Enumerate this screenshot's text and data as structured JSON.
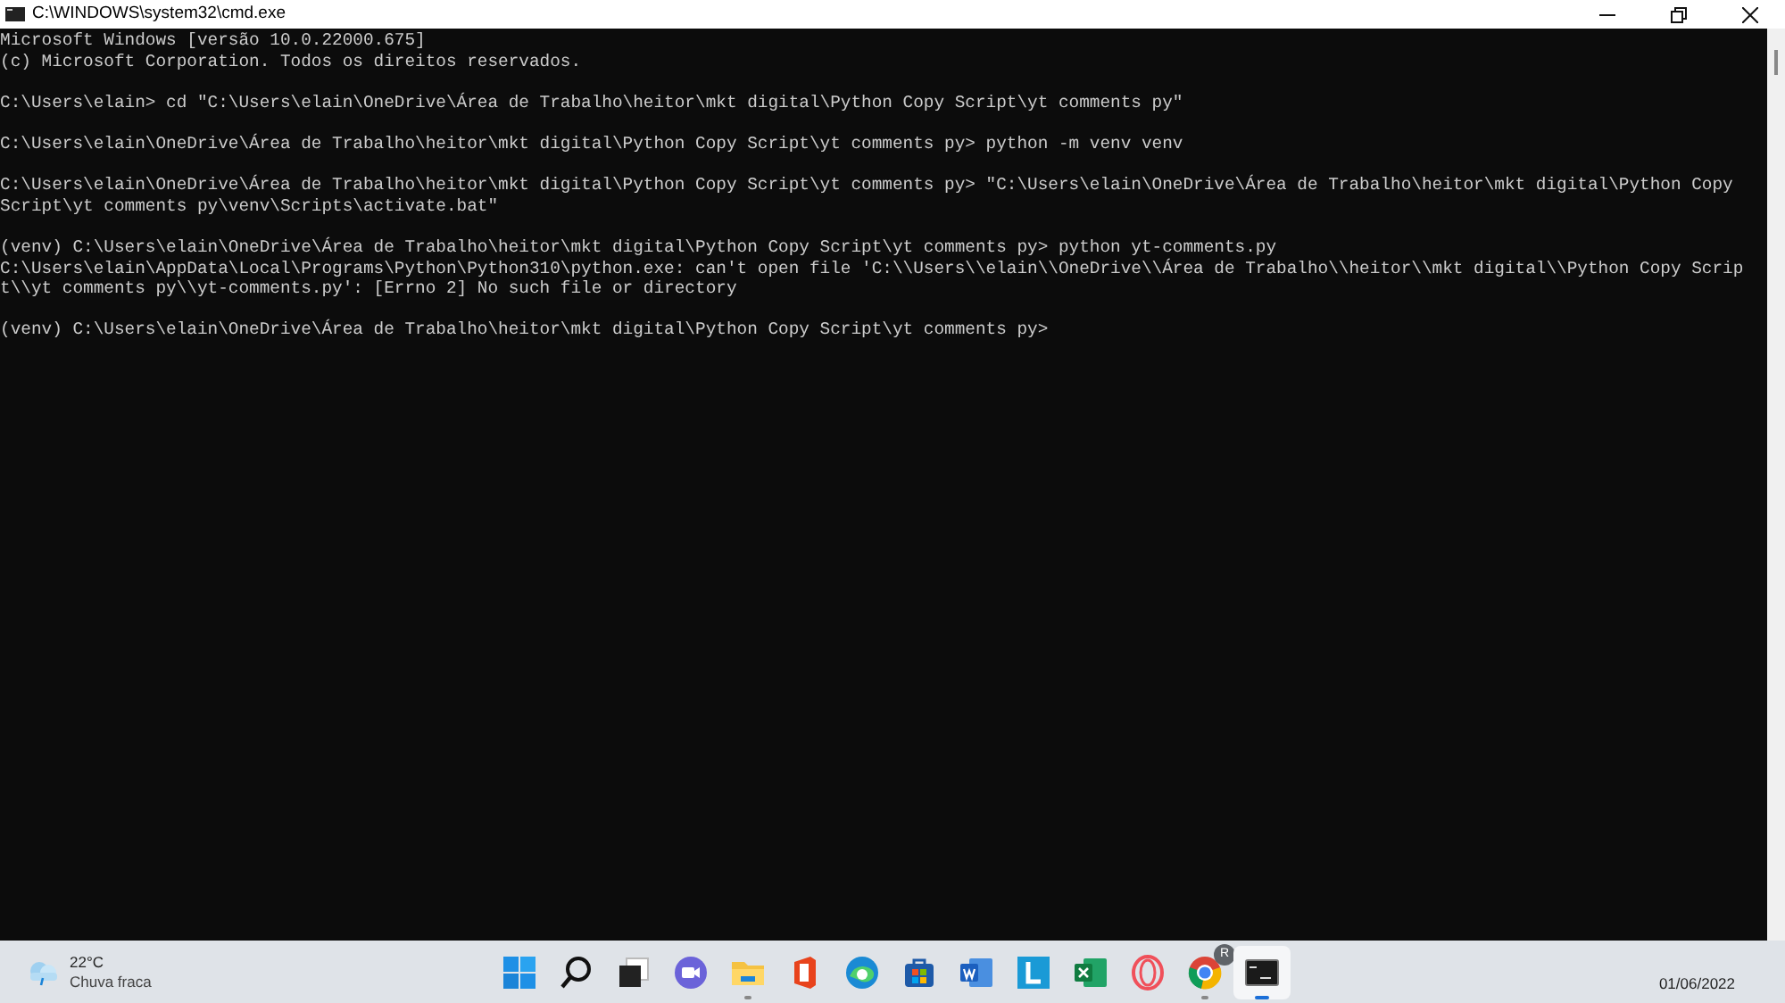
{
  "window": {
    "title": "C:\\WINDOWS\\system32\\cmd.exe"
  },
  "console": {
    "blocks": [
      [
        "Microsoft Windows [versão 10.0.22000.675]",
        "(c) Microsoft Corporation. Todos os direitos reservados."
      ],
      [
        "C:\\Users\\elain> cd \"C:\\Users\\elain\\OneDrive\\Área de Trabalho\\heitor\\mkt digital\\Python Copy Script\\yt comments py\""
      ],
      [
        "C:\\Users\\elain\\OneDrive\\Área de Trabalho\\heitor\\mkt digital\\Python Copy Script\\yt comments py> python -m venv venv"
      ],
      [
        "C:\\Users\\elain\\OneDrive\\Área de Trabalho\\heitor\\mkt digital\\Python Copy Script\\yt comments py> \"C:\\Users\\elain\\OneDrive\\Área de Trabalho\\heitor\\mkt digital\\Python Copy",
        "Script\\yt comments py\\venv\\Scripts\\activate.bat\""
      ],
      [
        "(venv) C:\\Users\\elain\\OneDrive\\Área de Trabalho\\heitor\\mkt digital\\Python Copy Script\\yt comments py> python yt-comments.py",
        "C:\\Users\\elain\\AppData\\Local\\Programs\\Python\\Python310\\python.exe: can't open file 'C:\\\\Users\\\\elain\\\\OneDrive\\\\Área de Trabalho\\\\heitor\\\\mkt digital\\\\Python Copy Scrip",
        "t\\\\yt comments py\\\\yt-comments.py': [Errno 2] No such file or directory"
      ],
      [
        "(venv) C:\\Users\\elain\\OneDrive\\Área de Trabalho\\heitor\\mkt digital\\Python Copy Script\\yt comments py>"
      ]
    ]
  },
  "taskbar": {
    "weather": {
      "temperature": "22°C",
      "condition": "Chuva fraca"
    },
    "apps": [
      {
        "kind": "start",
        "running": false,
        "selected": false
      },
      {
        "kind": "search",
        "running": false,
        "selected": false
      },
      {
        "kind": "taskview",
        "running": false,
        "selected": false
      },
      {
        "kind": "chat",
        "running": false,
        "selected": false
      },
      {
        "kind": "explorer",
        "running": true,
        "selected": false
      },
      {
        "kind": "office",
        "running": false,
        "selected": false
      },
      {
        "kind": "edge",
        "running": false,
        "selected": false
      },
      {
        "kind": "store",
        "running": false,
        "selected": false
      },
      {
        "kind": "word",
        "running": false,
        "selected": false
      },
      {
        "kind": "lapp",
        "running": false,
        "selected": false
      },
      {
        "kind": "excel",
        "running": false,
        "selected": false
      },
      {
        "kind": "opera",
        "running": false,
        "selected": false
      },
      {
        "kind": "chrome",
        "running": true,
        "selected": false,
        "badge": "R"
      },
      {
        "kind": "terminal",
        "running": true,
        "selected": true
      }
    ],
    "date": "01/06/2022"
  }
}
